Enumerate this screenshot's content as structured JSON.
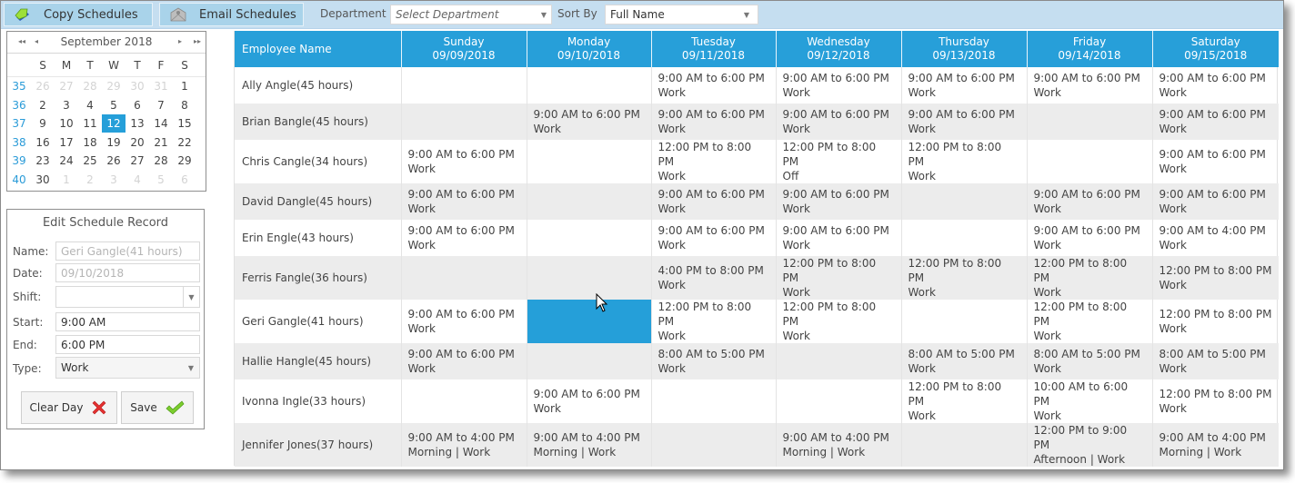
{
  "toolbar": {
    "copy_label": "Copy Schedules",
    "email_label": "Email Schedules",
    "department_label": "Department",
    "department_placeholder": "Select Department",
    "sort_label": "Sort By",
    "sort_value": "Full Name"
  },
  "calendar": {
    "title": "September 2018",
    "nav": {
      "prev_year": "◂◂",
      "prev_month": "◂",
      "next_month": "▸",
      "next_year": "▸▸"
    },
    "weekday_headers": [
      "S",
      "M",
      "T",
      "W",
      "T",
      "F",
      "S"
    ],
    "selected_day": "12",
    "weeks": [
      {
        "week": "35",
        "days": [
          {
            "d": "26",
            "other": true
          },
          {
            "d": "27",
            "other": true
          },
          {
            "d": "28",
            "other": true
          },
          {
            "d": "29",
            "other": true
          },
          {
            "d": "30",
            "other": true
          },
          {
            "d": "31",
            "other": true
          },
          {
            "d": "1"
          }
        ]
      },
      {
        "week": "36",
        "days": [
          {
            "d": "2"
          },
          {
            "d": "3"
          },
          {
            "d": "4"
          },
          {
            "d": "5"
          },
          {
            "d": "6"
          },
          {
            "d": "7"
          },
          {
            "d": "8"
          }
        ]
      },
      {
        "week": "37",
        "days": [
          {
            "d": "9"
          },
          {
            "d": "10"
          },
          {
            "d": "11"
          },
          {
            "d": "12"
          },
          {
            "d": "13"
          },
          {
            "d": "14"
          },
          {
            "d": "15"
          }
        ]
      },
      {
        "week": "38",
        "days": [
          {
            "d": "16"
          },
          {
            "d": "17"
          },
          {
            "d": "18"
          },
          {
            "d": "19"
          },
          {
            "d": "20"
          },
          {
            "d": "21"
          },
          {
            "d": "22"
          }
        ]
      },
      {
        "week": "39",
        "days": [
          {
            "d": "23"
          },
          {
            "d": "24"
          },
          {
            "d": "25"
          },
          {
            "d": "26"
          },
          {
            "d": "27"
          },
          {
            "d": "28"
          },
          {
            "d": "29"
          }
        ]
      },
      {
        "week": "40",
        "days": [
          {
            "d": "30"
          },
          {
            "d": "1",
            "other": true
          },
          {
            "d": "2",
            "other": true
          },
          {
            "d": "3",
            "other": true
          },
          {
            "d": "4",
            "other": true
          },
          {
            "d": "5",
            "other": true
          },
          {
            "d": "6",
            "other": true
          }
        ]
      }
    ]
  },
  "edit": {
    "title": "Edit Schedule Record",
    "name_label": "Name:",
    "name_value": "Geri Gangle(41 hours)",
    "date_label": "Date:",
    "date_value": "09/10/2018",
    "shift_label": "Shift:",
    "shift_value": "",
    "start_label": "Start:",
    "start_value": "9:00 AM",
    "end_label": "End:",
    "end_value": "6:00 PM",
    "type_label": "Type:",
    "type_value": "Work",
    "clear_label": "Clear Day",
    "save_label": "Save"
  },
  "grid": {
    "name_header": "Employee Name",
    "days": [
      {
        "day": "Sunday",
        "date": "09/09/2018"
      },
      {
        "day": "Monday",
        "date": "09/10/2018"
      },
      {
        "day": "Tuesday",
        "date": "09/11/2018"
      },
      {
        "day": "Wednesday",
        "date": "09/12/2018"
      },
      {
        "day": "Thursday",
        "date": "09/13/2018"
      },
      {
        "day": "Friday",
        "date": "09/14/2018"
      },
      {
        "day": "Saturday",
        "date": "09/15/2018"
      }
    ],
    "selected": {
      "row": 6,
      "col": 1
    },
    "rows": [
      {
        "name": "Ally Angle(45 hours)",
        "cells": [
          null,
          null,
          [
            "9:00 AM to 6:00 PM",
            "Work"
          ],
          [
            "9:00 AM to 6:00 PM",
            "Work"
          ],
          [
            "9:00 AM to 6:00 PM",
            "Work"
          ],
          [
            "9:00 AM to 6:00 PM",
            "Work"
          ],
          [
            "9:00 AM to 6:00 PM",
            "Work"
          ]
        ]
      },
      {
        "name": "Brian Bangle(45 hours)",
        "cells": [
          null,
          [
            "9:00 AM to 6:00 PM",
            "Work"
          ],
          [
            "9:00 AM to 6:00 PM",
            "Work"
          ],
          [
            "9:00 AM to 6:00 PM",
            "Work"
          ],
          [
            "9:00 AM to 6:00 PM",
            "Work"
          ],
          null,
          [
            "9:00 AM to 6:00 PM",
            "Work"
          ]
        ]
      },
      {
        "name": "Chris Cangle(34 hours)",
        "cells": [
          [
            "9:00 AM to 6:00 PM",
            "Work"
          ],
          null,
          [
            "12:00 PM to 8:00 PM",
            "Work"
          ],
          [
            "12:00 PM to 8:00 PM",
            "Off"
          ],
          [
            "12:00 PM to 8:00 PM",
            "Work"
          ],
          null,
          [
            "9:00 AM to 6:00 PM",
            "Work"
          ]
        ]
      },
      {
        "name": "David Dangle(45 hours)",
        "cells": [
          [
            "9:00 AM to 6:00 PM",
            "Work"
          ],
          null,
          [
            "9:00 AM to 6:00 PM",
            "Work"
          ],
          [
            "9:00 AM to 6:00 PM",
            "Work"
          ],
          null,
          [
            "9:00 AM to 6:00 PM",
            "Work"
          ],
          [
            "9:00 AM to 6:00 PM",
            "Work"
          ]
        ]
      },
      {
        "name": "Erin Engle(43 hours)",
        "cells": [
          [
            "9:00 AM to 6:00 PM",
            "Work"
          ],
          null,
          [
            "9:00 AM to 6:00 PM",
            "Work"
          ],
          [
            "9:00 AM to 6:00 PM",
            "Work"
          ],
          null,
          [
            "9:00 AM to 6:00 PM",
            "Work"
          ],
          [
            "9:00 AM to 4:00 PM",
            "Work"
          ]
        ]
      },
      {
        "name": "Ferris Fangle(36 hours)",
        "cells": [
          null,
          null,
          [
            "4:00 PM to 8:00 PM",
            "Work"
          ],
          [
            "12:00 PM to 8:00 PM",
            "Work"
          ],
          [
            "12:00 PM to 8:00 PM",
            "Work"
          ],
          [
            "12:00 PM to 8:00 PM",
            "Work"
          ],
          [
            "12:00 PM to 8:00 PM",
            "Work"
          ]
        ]
      },
      {
        "name": "Geri Gangle(41 hours)",
        "cells": [
          [
            "9:00 AM to 6:00 PM",
            "Work"
          ],
          null,
          [
            "12:00 PM to 8:00 PM",
            "Work"
          ],
          [
            "12:00 PM to 8:00 PM",
            "Work"
          ],
          null,
          [
            "12:00 PM to 8:00 PM",
            "Work"
          ],
          [
            "12:00 PM to 8:00 PM",
            "Work"
          ]
        ]
      },
      {
        "name": "Hallie Hangle(45 hours)",
        "cells": [
          [
            "9:00 AM to 6:00 PM",
            "Work"
          ],
          null,
          [
            "8:00 AM to 5:00 PM",
            "Work"
          ],
          null,
          [
            "8:00 AM to 5:00 PM",
            "Work"
          ],
          [
            "8:00 AM to 5:00 PM",
            "Work"
          ],
          [
            "8:00 AM to 5:00 PM",
            "Work"
          ]
        ]
      },
      {
        "name": "Ivonna Ingle(33 hours)",
        "cells": [
          null,
          [
            "9:00 AM to 6:00 PM",
            "Work"
          ],
          null,
          null,
          [
            "12:00 PM to 8:00 PM",
            "Work"
          ],
          [
            "10:00 AM to 6:00 PM",
            "Work"
          ],
          [
            "12:00 PM to 8:00 PM",
            "Work"
          ]
        ]
      },
      {
        "name": "Jennifer Jones(37 hours)",
        "cells": [
          [
            "9:00 AM to 4:00 PM",
            "Morning | Work"
          ],
          [
            "9:00 AM to 4:00 PM",
            "Morning | Work"
          ],
          null,
          [
            "9:00 AM to 4:00 PM",
            "Morning | Work"
          ],
          null,
          [
            "12:00 PM to 9:00 PM",
            "Afternoon | Work"
          ],
          [
            "9:00 AM to 4:00 PM",
            "Morning | Work"
          ]
        ]
      }
    ]
  },
  "colors": {
    "accent": "#279fd9",
    "toolbar_bg": "#c5def0",
    "toolbar_button": "#a9d3ea",
    "alt_row": "#ececec"
  }
}
